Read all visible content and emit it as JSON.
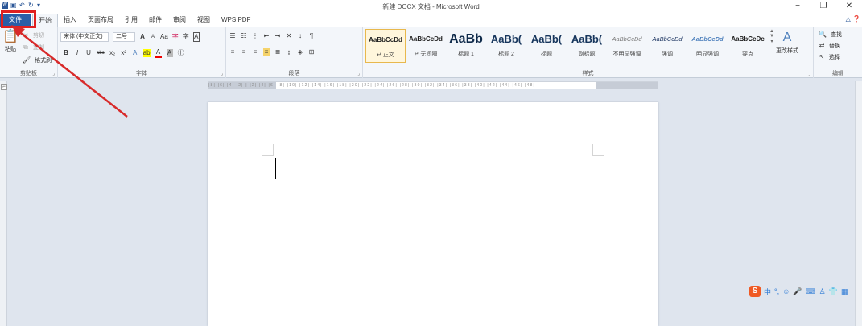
{
  "title": "新建 DOCX 文档 - Microsoft Word",
  "qat": {
    "save_icon": "save-icon",
    "undo_icon": "undo-icon",
    "redo_icon": "redo-icon",
    "customize_icon": "customize-icon"
  },
  "window_controls": {
    "minimize": "−",
    "maximize": "❐",
    "close": "✕"
  },
  "tabs": [
    "文件",
    "开始",
    "插入",
    "页面布局",
    "引用",
    "邮件",
    "审阅",
    "视图",
    "WPS PDF"
  ],
  "clipboard": {
    "paste": "粘贴",
    "cut": "剪切",
    "copy": "复制",
    "format_painter": "格式刷",
    "label": "剪贴板"
  },
  "font": {
    "family": "宋体 (中文正文)",
    "size": "二号",
    "label": "字体",
    "grow": "A",
    "shrink": "A",
    "case": "Aa",
    "clear": "字",
    "bold": "B",
    "italic": "I",
    "underline": "U",
    "strike": "abc",
    "sub": "x₂",
    "sup": "x²",
    "color_a": "A",
    "shade": "A",
    "border": "A",
    "circle": "字"
  },
  "paragraph": {
    "label": "段落"
  },
  "styles": {
    "label": "样式",
    "items": [
      {
        "sample": "AaBbCcDd",
        "name": "↵ 正文"
      },
      {
        "sample": "AaBbCcDd",
        "name": "↵ 无间隔"
      },
      {
        "sample": "AaBb",
        "name": "标题 1"
      },
      {
        "sample": "AaBb(",
        "name": "标题 2"
      },
      {
        "sample": "AaBb(",
        "name": "标题"
      },
      {
        "sample": "AaBb(",
        "name": "副标题"
      },
      {
        "sample": "AaBbCcDd",
        "name": "不明显强调"
      },
      {
        "sample": "AaBbCcDd",
        "name": "强调"
      },
      {
        "sample": "AaBbCcDd",
        "name": "明显强调"
      },
      {
        "sample": "AaBbCcDc",
        "name": "要点"
      }
    ],
    "change": "更改样式"
  },
  "editing": {
    "find": "查找",
    "replace": "替换",
    "select": "选择",
    "label": "编辑"
  },
  "ruler_text": "|8| |6| |4| |2| | |2| |4| |6| |8| |10| |12| |14| |16| |18| |20| |22| |24| |26| |28| |30| |32| |34| |36| |38| |40| |42| |44| |46| |48|",
  "ime": {
    "logo": "S",
    "mode": "中"
  },
  "colors": {
    "file_tab": "#2a5ea7",
    "highlight": "#e02020",
    "ribbon": "#f3f6fa"
  }
}
